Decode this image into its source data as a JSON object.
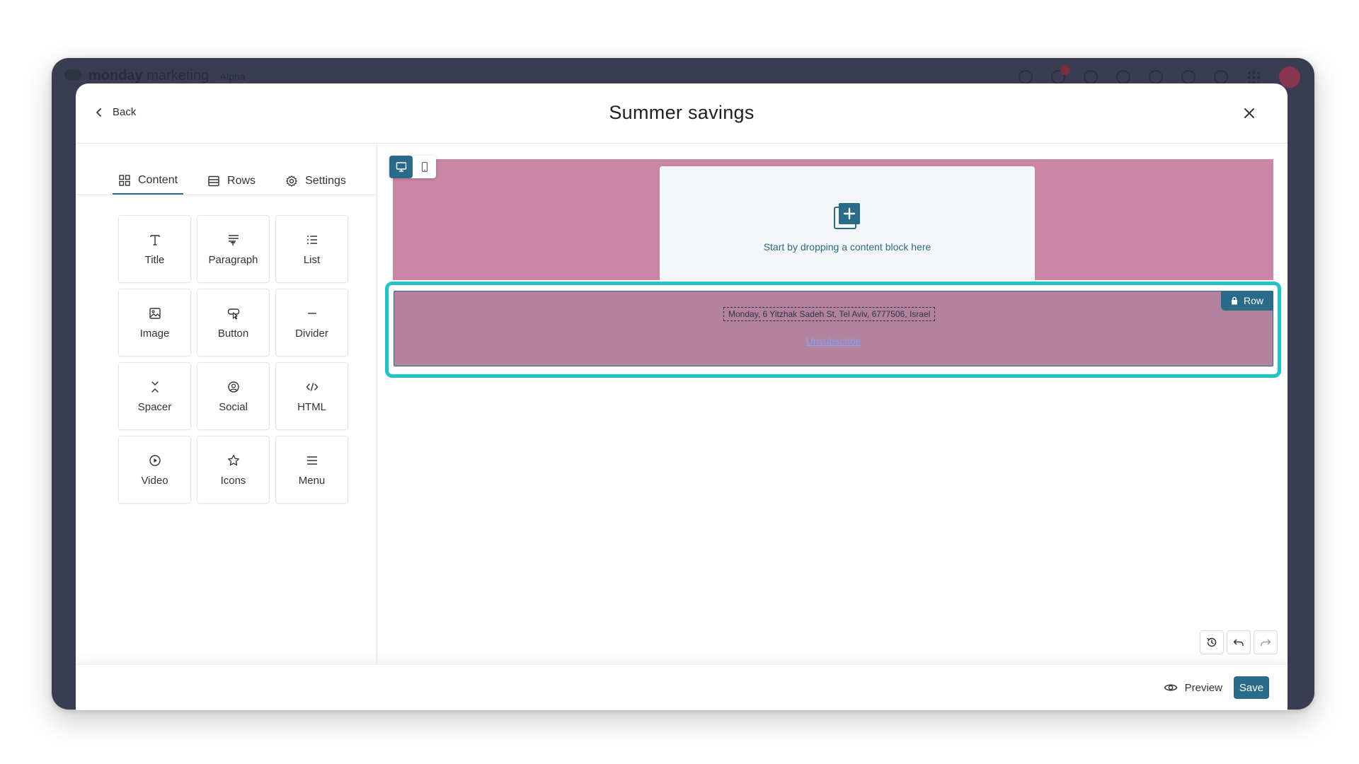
{
  "app": {
    "brand_name": "monday",
    "brand_product": "marketing",
    "brand_tag": "Alpha",
    "icons": [
      "settings-icon",
      "bell-icon",
      "inbox-icon",
      "invite-icon",
      "apps-icon",
      "search-icon",
      "help-icon",
      "apps-grid-icon",
      "avatar"
    ]
  },
  "modal": {
    "title": "Summer savings",
    "back_label": "Back",
    "close_icon": "close-icon"
  },
  "sidebar": {
    "tabs": [
      {
        "label": "Content",
        "icon": "grid-icon",
        "active": true
      },
      {
        "label": "Rows",
        "icon": "rows-icon",
        "active": false
      },
      {
        "label": "Settings",
        "icon": "gear-icon",
        "active": false
      }
    ],
    "blocks": [
      {
        "label": "Title",
        "icon": "title-icon"
      },
      {
        "label": "Paragraph",
        "icon": "paragraph-icon"
      },
      {
        "label": "List",
        "icon": "list-icon"
      },
      {
        "label": "Image",
        "icon": "image-icon"
      },
      {
        "label": "Button",
        "icon": "button-icon"
      },
      {
        "label": "Divider",
        "icon": "divider-icon"
      },
      {
        "label": "Spacer",
        "icon": "spacer-icon"
      },
      {
        "label": "Social",
        "icon": "social-icon"
      },
      {
        "label": "HTML",
        "icon": "html-icon"
      },
      {
        "label": "Video",
        "icon": "video-icon"
      },
      {
        "label": "Icons",
        "icon": "star-icon"
      },
      {
        "label": "Menu",
        "icon": "menu-icon"
      }
    ]
  },
  "canvas": {
    "device_active": "desktop",
    "drop_text": "Start by dropping a content block here",
    "footer_address": "Monday, 6 Yitzhak Sadeh St, Tel Aviv, 6777506, Israel",
    "unsubscribe": "Unsubscribe",
    "row_badge": "Row",
    "colors": {
      "pink_row": "#c985a4",
      "selected_row": "#b3829d",
      "selection_border": "#22c4c8",
      "accent": "#2b6b8a"
    }
  },
  "footer": {
    "preview_label": "Preview",
    "save_label": "Save"
  }
}
